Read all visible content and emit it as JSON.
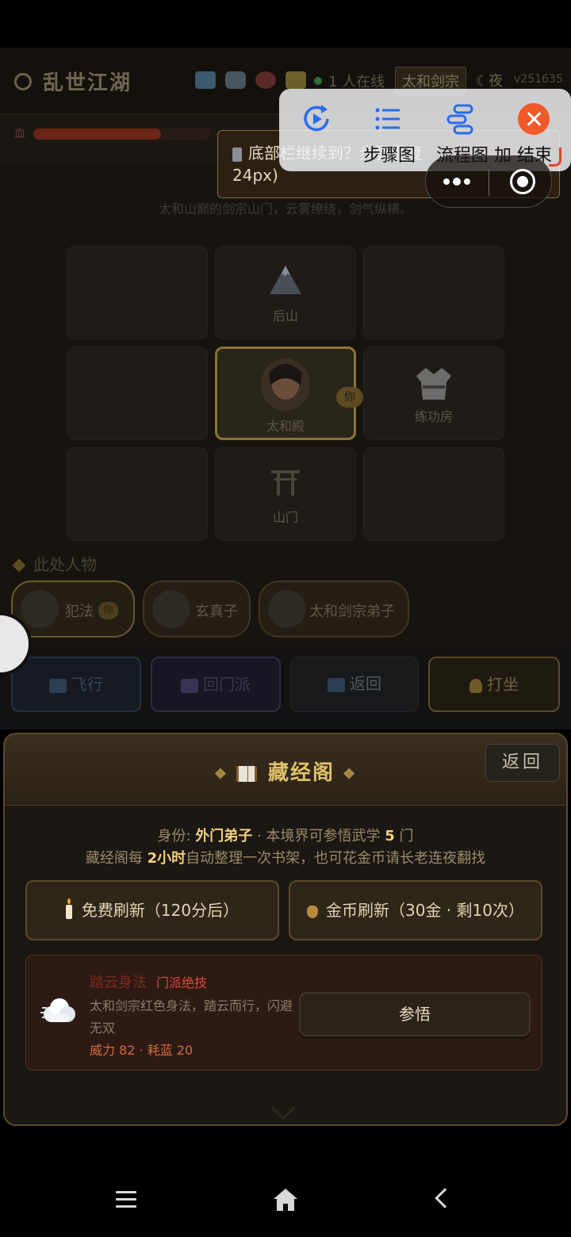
{
  "game": {
    "title": "乱世江湖",
    "online_count": "1",
    "online_suffix": "人在线",
    "sect": "太和剑宗",
    "time_of_day": "夜",
    "version": "v251635",
    "hp_label": "血",
    "hp_fraction": 0.72,
    "location_desc": "太和山巅的剑宗山门，云雾缭绕，剑气纵横。",
    "map_tiles": [
      {
        "label": "",
        "icon": ""
      },
      {
        "label": "后山",
        "icon": "mountain-icon"
      },
      {
        "label": "",
        "icon": ""
      },
      {
        "label": "",
        "icon": ""
      },
      {
        "label": "太和殿",
        "icon": "player-portrait",
        "current": true
      },
      {
        "label": "练功房",
        "icon": "robe-icon"
      },
      {
        "label": "",
        "icon": ""
      },
      {
        "label": "山门",
        "icon": "torii-gate-icon"
      },
      {
        "label": "",
        "icon": ""
      }
    ],
    "you_badge": "你",
    "people_title": "此处人物",
    "npcs": [
      {
        "name": "犯法",
        "badge": "你"
      },
      {
        "name": "玄真子",
        "badge": ""
      },
      {
        "name": "太和剑宗弟子",
        "badge": ""
      }
    ],
    "actions": {
      "fly": "飞行",
      "return_sect": "回门派",
      "back": "返回",
      "meditate": "打坐"
    }
  },
  "overlay": {
    "tooltip_line1": "底部栏继续到？步骤图复",
    "tooltip_line2": "24px)",
    "recorder": {
      "replay": "",
      "steps": "步骤图",
      "flow": "流程图",
      "flow_prefix": "加",
      "end": "结束"
    }
  },
  "modal": {
    "title": "藏经阁",
    "back": "返回",
    "identity_label": "身份:",
    "identity_value": "外门弟子",
    "identity_suffix": "· 本境界可参悟武学",
    "learn_count": "5",
    "learn_unit": "门",
    "refresh_info_prefix": "藏经阁每",
    "refresh_info_value": "2小时",
    "refresh_info_suffix": "自动整理一次书架，也可花金币请长老连夜翻找",
    "free_refresh": "免费刷新（120分后）",
    "gold_refresh": "金币刷新（30金 · 剩10次）",
    "skill": {
      "name": "踏云身法",
      "tag": "门派绝技",
      "desc": "太和剑宗红色身法，踏云而行，闪避无双",
      "stats": "威力 82 · 耗蓝 20",
      "learn": "参悟"
    }
  },
  "colors": {
    "accent_gold": "#e0c069",
    "skill_red": "#e0463a",
    "close_orange": "#f05a28"
  }
}
